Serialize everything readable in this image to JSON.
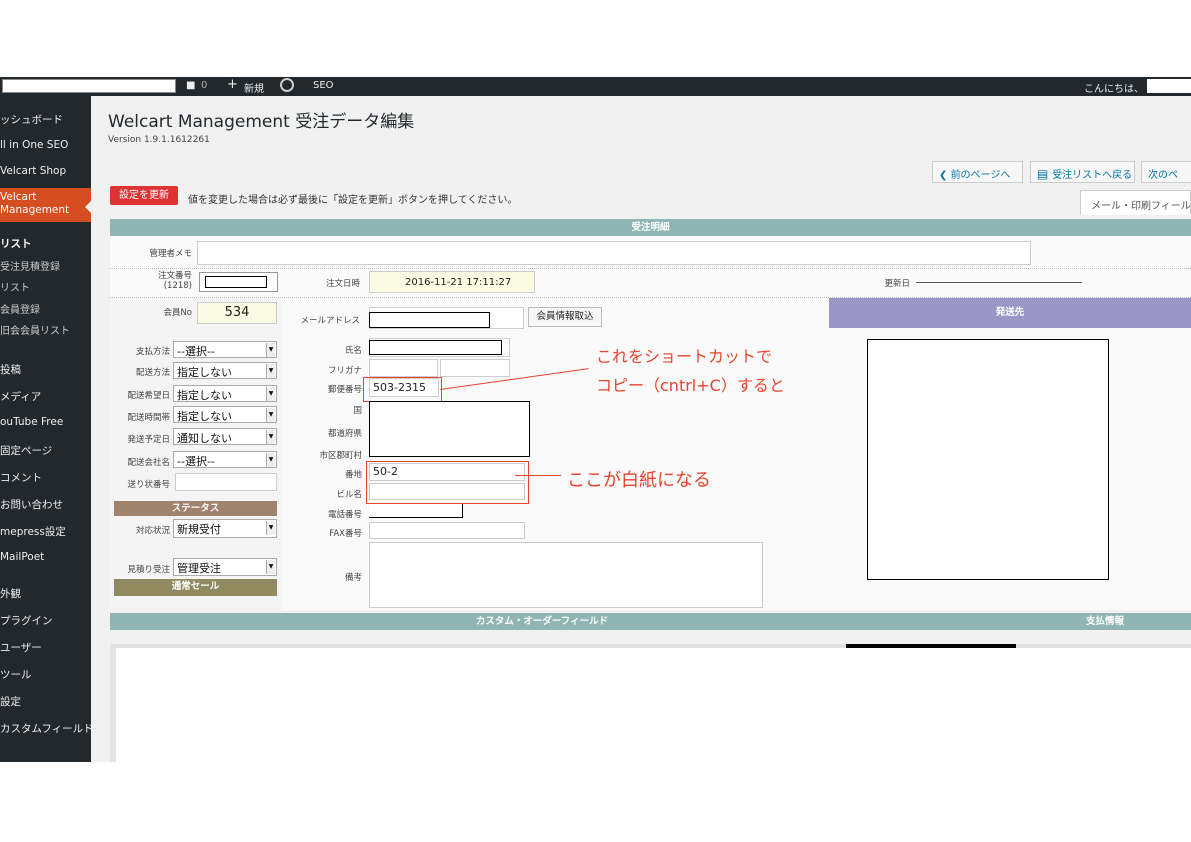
{
  "adminbar": {
    "comments_count": "0",
    "new_label": "新規",
    "seo_label": "SEO",
    "greeting": "こんにちは、"
  },
  "sidebar": {
    "items": [
      {
        "label": "ッシュボード"
      },
      {
        "label": "ll in One SEO"
      },
      {
        "label": "Velcart Shop"
      },
      {
        "label": "Velcart\nManagement"
      },
      {
        "label": "リスト"
      },
      {
        "label": "受注見積登録"
      },
      {
        "label": "リスト"
      },
      {
        "label": "会員登録"
      },
      {
        "label": "旧会会員リスト"
      },
      {
        "label": "投稿"
      },
      {
        "label": "メディア"
      },
      {
        "label": "ouTube Free"
      },
      {
        "label": "固定ページ"
      },
      {
        "label": "コメント"
      },
      {
        "label": "お問い合わせ"
      },
      {
        "label": "mepress設定"
      },
      {
        "label": "MailPoet"
      },
      {
        "label": "外観"
      },
      {
        "label": "プラグイン"
      },
      {
        "label": "ユーザー"
      },
      {
        "label": "ツール"
      },
      {
        "label": "設定"
      },
      {
        "label": "カスタムフィールド"
      }
    ]
  },
  "page": {
    "title": "Welcart Management 受注データ編集",
    "version": "Version 1.9.1.1612261",
    "prev_page": "前のページへ",
    "back_to_list": "受注リストへ戻る",
    "next_page": "次のペ",
    "update_button": "設定を更新",
    "notice": "値を変更した場合は必ず最後に「設定を更新」ボタンを押してください。",
    "mail_tab": "メール・印刷フィール"
  },
  "order": {
    "section_title": "受注明細",
    "admin_memo_label": "管理者メモ",
    "order_number_label": "注文番号",
    "order_number_sub": "(1218)",
    "order_date_label": "注文日時",
    "order_date": "2016-11-21 17:11:27",
    "updated_label": "更新日",
    "member_no_label": "会員No",
    "member_no": "534",
    "email_label": "メールアドレス",
    "member_fetch_button": "会員情報取込",
    "shipping_to": "発送先",
    "left_fields": [
      {
        "label": "支払方法",
        "value": "--選択--"
      },
      {
        "label": "配送方法",
        "value": "指定しない"
      },
      {
        "label": "配送希望日",
        "value": "指定しない"
      },
      {
        "label": "配送時間帯",
        "value": "指定しない"
      },
      {
        "label": "発送予定日",
        "value": "通知しない"
      },
      {
        "label": "配送会社名",
        "value": "--選択--"
      }
    ],
    "tracking_label": "送り状番号",
    "status_header": "ステータス",
    "status_label": "対応状況",
    "status_value": "新規受付",
    "estimate_label": "見積り受注",
    "estimate_value": "管理受注",
    "sale_header": "通常セール",
    "mid_fields": {
      "name": "氏名",
      "furigana": "フリガナ",
      "zip": "郵便番号",
      "zip_value": "503-2315",
      "country": "国",
      "prefecture": "都道府県",
      "city": "市区郡町村",
      "address": "番地",
      "address_value": "50-2",
      "building": "ビル名",
      "phone": "電話番号",
      "fax": "FAX番号",
      "remarks": "備考"
    },
    "custom_order_field": "カスタム・オーダーフィールド",
    "payment_info": "支払情報"
  },
  "annotations": {
    "copy_line1": "これをショートカットで",
    "copy_line2": "コピー（cntrl+C）すると",
    "blank_note": "ここが白紙になる"
  },
  "colors": {
    "admin_bar": "#23282d",
    "accent_red": "#d54e21",
    "table_header": "#8fb6b3",
    "status_header": "#a0826d",
    "sale_header": "#8f8a60",
    "shipping_header": "#9a97c7",
    "annotation": "#e8442b"
  }
}
